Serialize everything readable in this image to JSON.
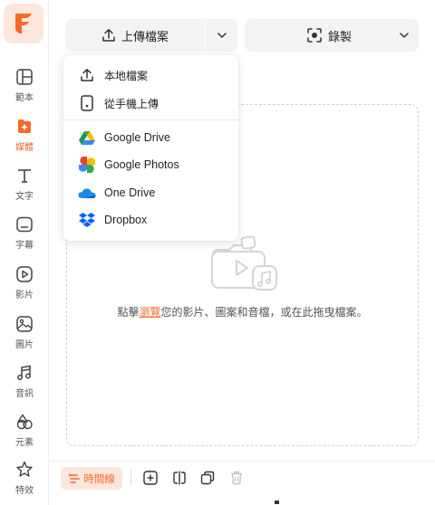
{
  "sidebar": {
    "logo": "F",
    "items": [
      {
        "label": "範本",
        "icon": "template-icon"
      },
      {
        "label": "媒體",
        "icon": "media-plus-icon"
      },
      {
        "label": "文字",
        "icon": "text-t-icon"
      },
      {
        "label": "字幕",
        "icon": "subtitle-icon"
      },
      {
        "label": "影片",
        "icon": "play-circle-icon"
      },
      {
        "label": "圖片",
        "icon": "image-icon"
      },
      {
        "label": "音訊",
        "icon": "music-note-icon"
      },
      {
        "label": "元素",
        "icon": "shapes-icon"
      },
      {
        "label": "特效",
        "icon": "star-effect-icon"
      }
    ]
  },
  "toolbar": {
    "upload_label": "上傳檔案",
    "record_label": "錄製"
  },
  "upload_menu": {
    "items": [
      {
        "label": "本地檔案",
        "icon": "upload-icon"
      },
      {
        "label": "從手機上傳",
        "icon": "phone-icon"
      },
      {
        "label": "Google Drive",
        "icon": "google-drive-icon"
      },
      {
        "label": "Google Photos",
        "icon": "google-photos-icon"
      },
      {
        "label": "One Drive",
        "icon": "onedrive-icon"
      },
      {
        "label": "Dropbox",
        "icon": "dropbox-icon"
      }
    ]
  },
  "dropzone": {
    "text_before": "點擊",
    "link": "瀏覽",
    "text_after": "您的影片、圖案和音檔，或在此拖曳檔案。"
  },
  "bottombar": {
    "timeline_label": "時間線"
  },
  "colors": {
    "accent": "#f26b2d",
    "accent_light": "#fde6dc"
  }
}
